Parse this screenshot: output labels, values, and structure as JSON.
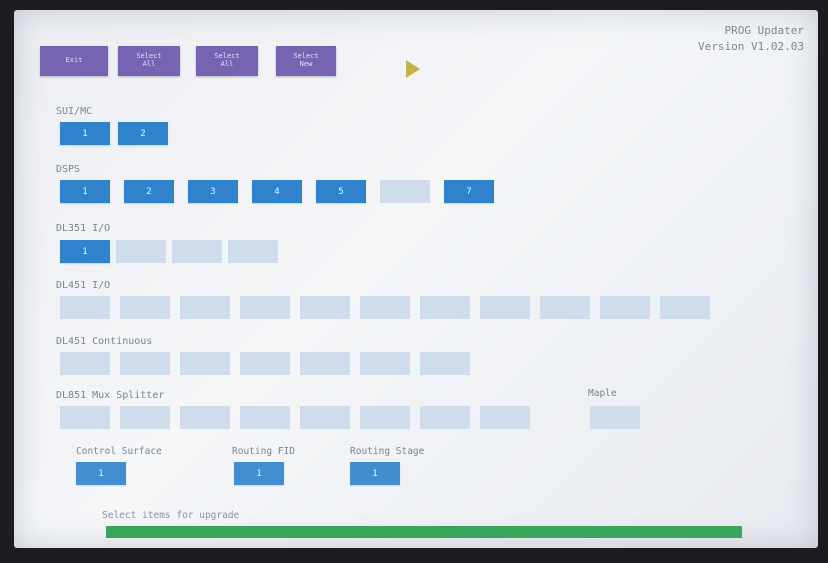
{
  "toolbar": {
    "buttons": [
      {
        "line1": "Exit",
        "line2": ""
      },
      {
        "line1": "Select",
        "line2": "All"
      },
      {
        "line1": "Select",
        "line2": "All"
      },
      {
        "line1": "Select",
        "line2": "New"
      }
    ]
  },
  "header": {
    "app_title": "PROG Updater",
    "version": "Version V1.02.03"
  },
  "sections": {
    "sbc_mc": {
      "title": "SUI/MC",
      "buttons": [
        "1",
        "2"
      ]
    },
    "dsps": {
      "title": "DSPS",
      "buttons": [
        "1",
        "2",
        "3",
        "4",
        "5",
        "",
        "7"
      ]
    },
    "dl351_io_a": {
      "title": "DL351 I/O",
      "buttons": [
        "1",
        "",
        "",
        ""
      ]
    },
    "dl451_io": {
      "title": "DL451 I/O",
      "buttons": [
        "",
        "",
        "",
        "",
        "",
        "",
        "",
        "",
        "",
        "",
        "",
        ""
      ]
    },
    "dl451_cont": {
      "title": "DL451 Continuous",
      "buttons": [
        "",
        "",
        "",
        "",
        "",
        "",
        ""
      ]
    },
    "dl851_mux": {
      "title": "DL851 Mux Splitter",
      "buttons": [
        "",
        "",
        "",
        "",
        "",
        "",
        "",
        "",
        ""
      ]
    },
    "maple": {
      "title": "Maple",
      "buttons": [
        ""
      ]
    },
    "control_surface": {
      "title": "Control Surface",
      "button": "1"
    },
    "routing_fid": {
      "title": "Routing FID",
      "button": "1"
    },
    "routing_stage": {
      "title": "Routing Stage",
      "button": "1"
    }
  },
  "status": {
    "message": "Select items for upgrade",
    "progress": 1.0
  },
  "colors": {
    "toolbar_button": "#7664b3",
    "selected_button": "#2f83cc",
    "unselected_button": "#cfdceb",
    "progress": "#3aa45a"
  }
}
